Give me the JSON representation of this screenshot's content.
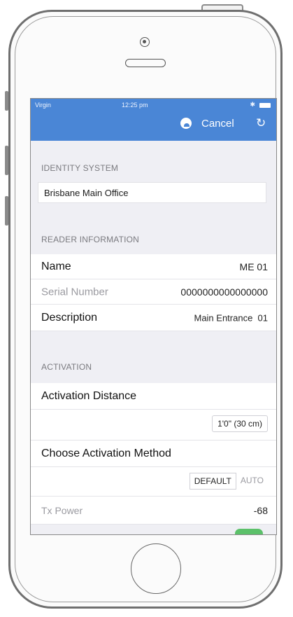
{
  "status_bar": {
    "carrier": "Virgin",
    "time": "12:25 pm"
  },
  "nav": {
    "cancel_label": "Cancel",
    "avatar_icon": "user-avatar-icon",
    "refresh_icon": "refresh-icon"
  },
  "identity": {
    "header": "IDENTITY SYSTEM",
    "value": "Brisbane Main Office"
  },
  "reader": {
    "header": "READER INFORMATION",
    "rows": [
      {
        "label": "Name",
        "value": "ME 01"
      },
      {
        "label": "Serial Number",
        "value": "0000000000000000"
      },
      {
        "label": "Description",
        "value": "Main Entrance  01"
      }
    ]
  },
  "activation": {
    "header": "ACTIVATION",
    "distance_label": "Activation Distance",
    "distance_value": "1'0\" (30 cm)",
    "method_label": "Choose Activation Method",
    "method_options": [
      "DEFAULT",
      "AUTO"
    ],
    "method_selected": "DEFAULT",
    "tx_power_label": "Tx Power",
    "tx_power_value": "-68"
  },
  "colors": {
    "nav_bar": "#4a86d6",
    "background": "#efeff4",
    "toggle_on": "#5cc16a"
  }
}
